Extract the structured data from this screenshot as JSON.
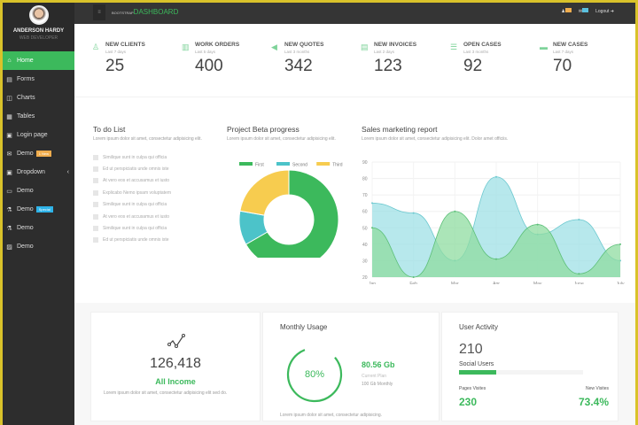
{
  "profile": {
    "name": "ANDERSON HARDY",
    "role": "WEB DEVELOPER"
  },
  "sidebar": {
    "items": [
      {
        "label": "Home",
        "icon": "home-icon",
        "glyph": "⌂",
        "active": true
      },
      {
        "label": "Forms",
        "icon": "forms-icon",
        "glyph": "▤"
      },
      {
        "label": "Charts",
        "icon": "charts-icon",
        "glyph": "◫"
      },
      {
        "label": "Tables",
        "icon": "tables-icon",
        "glyph": "▦"
      },
      {
        "label": "Login page",
        "icon": "login-icon",
        "glyph": "▣"
      },
      {
        "label": "Demo",
        "icon": "mail-icon",
        "glyph": "✉",
        "badge": "1 New",
        "badge_color": "#f0ad4e"
      },
      {
        "label": "Dropdown",
        "icon": "dropdown-icon",
        "glyph": "▣",
        "chevron": "‹"
      },
      {
        "label": "Demo",
        "icon": "monitor-icon",
        "glyph": "▭"
      },
      {
        "label": "Demo",
        "icon": "flask-icon",
        "glyph": "⚗",
        "badge": "Special",
        "badge_color": "#2eb3e8"
      },
      {
        "label": "Demo",
        "icon": "flask-icon",
        "glyph": "⚗"
      },
      {
        "label": "Demo",
        "icon": "image-icon",
        "glyph": "▨"
      }
    ]
  },
  "topbar": {
    "brand_small": "BOOTSTRAP",
    "brand": "DASHBOARD",
    "logout": "Logout",
    "notif_colors": [
      "#f0ad4e",
      "#5bc0de"
    ]
  },
  "stats": [
    {
      "title": "NEW CLIENTS",
      "sub": "Last 7 days",
      "value": "25",
      "icon": "user-icon",
      "glyph": "♙"
    },
    {
      "title": "WORK ORDERS",
      "sub": "Last 5 days",
      "value": "400",
      "icon": "clipboard-icon",
      "glyph": "▥"
    },
    {
      "title": "NEW QUOTES",
      "sub": "Last 3 months",
      "value": "342",
      "icon": "megaphone-icon",
      "glyph": "◀"
    },
    {
      "title": "NEW INVOICES",
      "sub": "Last 2 days",
      "value": "123",
      "icon": "invoice-icon",
      "glyph": "▤"
    },
    {
      "title": "OPEN CASES",
      "sub": "Last 3 months",
      "value": "92",
      "icon": "list-icon",
      "glyph": "☰"
    },
    {
      "title": "NEW CASES",
      "sub": "Last 7 days",
      "value": "70",
      "icon": "cases-icon",
      "glyph": "▬"
    }
  ],
  "todo": {
    "title": "To do List",
    "desc": "Lorem ipsum dolor sit amet, consectetur adipisicing elit.",
    "items": [
      "Similique sunt in culpa qui officia",
      "Ed ut perspiciatis unde omnis iste",
      "At vero eos et accusamus et iusto",
      "Explicabo Nemo ipsam voluptatem",
      "Similique sunt in culpa qui officia",
      "At vero eos et accusamus et iusto",
      "Similique sunt in culpa qui officia",
      "Ed ut perspiciatis unde omnis iste"
    ]
  },
  "project": {
    "title": "Project Beta progress",
    "desc": "Lorem ipsum dolor sit amet, consectetur adipisicing elit."
  },
  "sales": {
    "title": "Sales marketing report",
    "desc": "Lorem ipsum dolor sit amet, consectetur adipisicing elit. Dolor amet officiis."
  },
  "chart_data": [
    {
      "type": "pie",
      "donut": true,
      "categories": [
        "First",
        "Second",
        "Third"
      ],
      "values": [
        300,
        50,
        100
      ],
      "colors": [
        "#3cb95c",
        "#4cc3c9",
        "#f7cc4f"
      ],
      "legend": "top"
    },
    {
      "type": "area",
      "categories": [
        "Jan",
        "Feb",
        "Mar",
        "Apr",
        "May",
        "June",
        "July"
      ],
      "ylim": [
        20,
        90
      ],
      "yticks": [
        20,
        30,
        40,
        50,
        60,
        70,
        80,
        90
      ],
      "grid": true,
      "series": [
        {
          "values": [
            65,
            59,
            30,
            81,
            46,
            55,
            30
          ],
          "color": "#9fe0e6"
        },
        {
          "values": [
            50,
            20,
            60,
            31,
            52,
            22,
            40
          ],
          "color": "#8fdca0"
        }
      ]
    }
  ],
  "income": {
    "value": "126,418",
    "label": "All Income",
    "desc": "Lorem ipsum dolor sit amet, consectetur adipisicing elit sed do."
  },
  "usage": {
    "title": "Monthly Usage",
    "percent": 80,
    "percent_label": "80%",
    "amount": "80.56 Gb",
    "plan_label": "Current Plan",
    "plan": "100 Gb Monthly",
    "desc": "Lorem ipsum dolor sit amet, consectetur adipisicing."
  },
  "activity": {
    "title": "User Activity",
    "value": "210",
    "label": "Social Users",
    "progress": 30,
    "pages_label": "Pages Visites",
    "pages": "230",
    "new_label": "New Visites",
    "new": "73.4%"
  }
}
